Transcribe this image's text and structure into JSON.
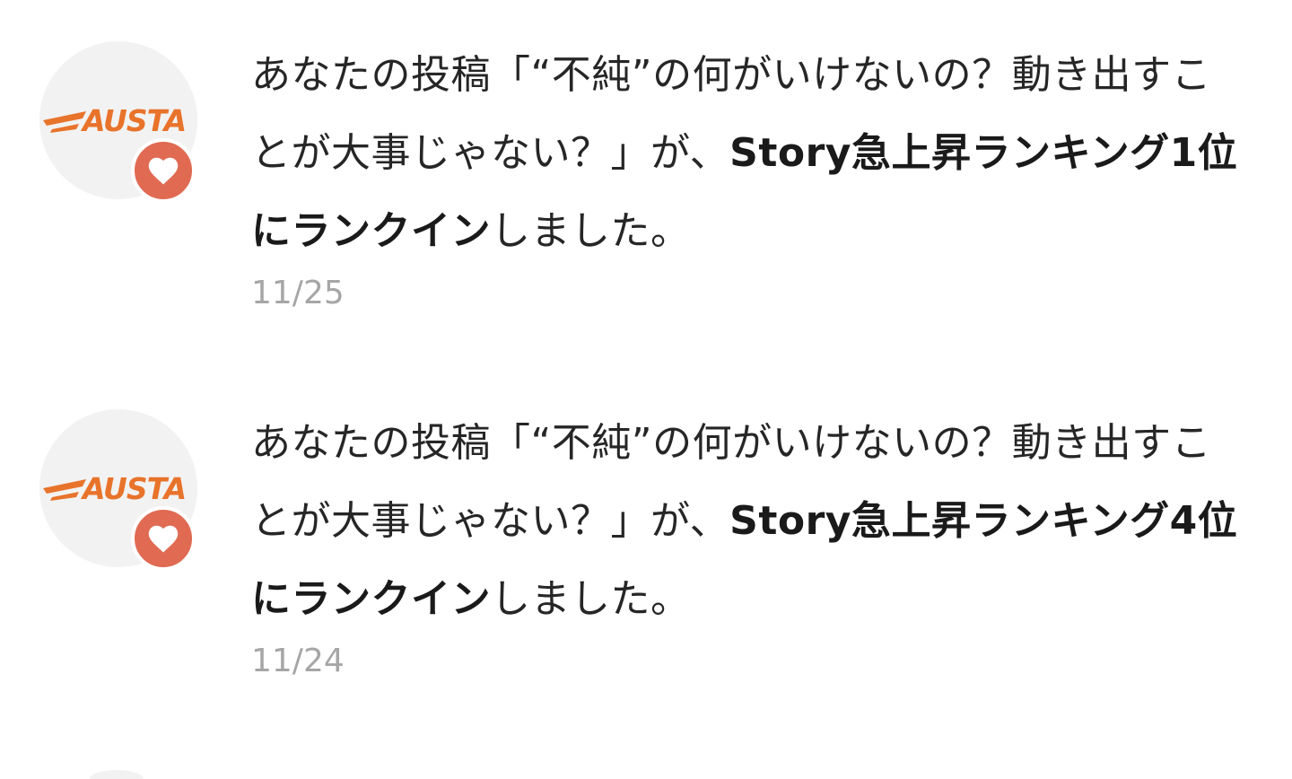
{
  "colors": {
    "accent_heart": "#e06a52",
    "logo_orange": "#e8732b",
    "avatar_bg": "#f2f2f2",
    "date_text": "#a6a6a6"
  },
  "notifications": [
    {
      "avatar_logo": "AUSTA",
      "badge_icon": "heart-icon",
      "text_before": "あなたの投稿「“不純”の何がいけないの？動き出すことが大事じゃない？」が、",
      "text_bold": "Story急上昇ランキング1位にランクイン",
      "text_after": "しました。",
      "date": "11/25"
    },
    {
      "avatar_logo": "AUSTA",
      "badge_icon": "heart-icon",
      "text_before": "あなたの投稿「“不純”の何がいけないの？動き出すことが大事じゃない？」が、",
      "text_bold": "Story急上昇ランキング4位にランクイン",
      "text_after": "しました。",
      "date": "11/24"
    }
  ]
}
